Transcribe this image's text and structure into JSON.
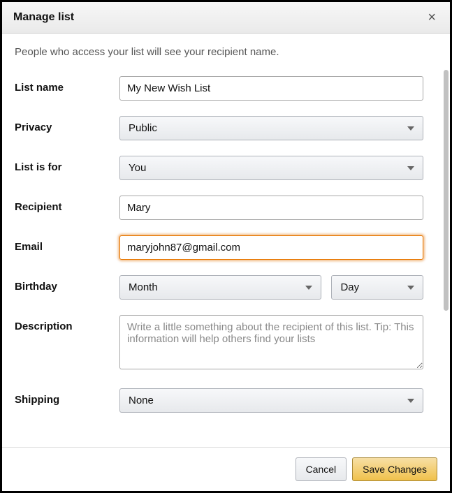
{
  "header": {
    "title": "Manage list"
  },
  "subtext": "People who access your list will see your recipient name.",
  "labels": {
    "list_name": "List name",
    "privacy": "Privacy",
    "list_is_for": "List is for",
    "recipient": "Recipient",
    "email": "Email",
    "birthday": "Birthday",
    "description": "Description",
    "shipping": "Shipping"
  },
  "fields": {
    "list_name": "My New Wish List",
    "privacy": "Public",
    "list_is_for": "You",
    "recipient": "Mary",
    "email": "maryjohn87@gmail.com",
    "birthday_month": "Month",
    "birthday_day": "Day",
    "description_placeholder": "Write a little something about the recipient of this list. Tip: This information will help others find your lists",
    "shipping": "None"
  },
  "footer": {
    "cancel": "Cancel",
    "save": "Save Changes"
  }
}
